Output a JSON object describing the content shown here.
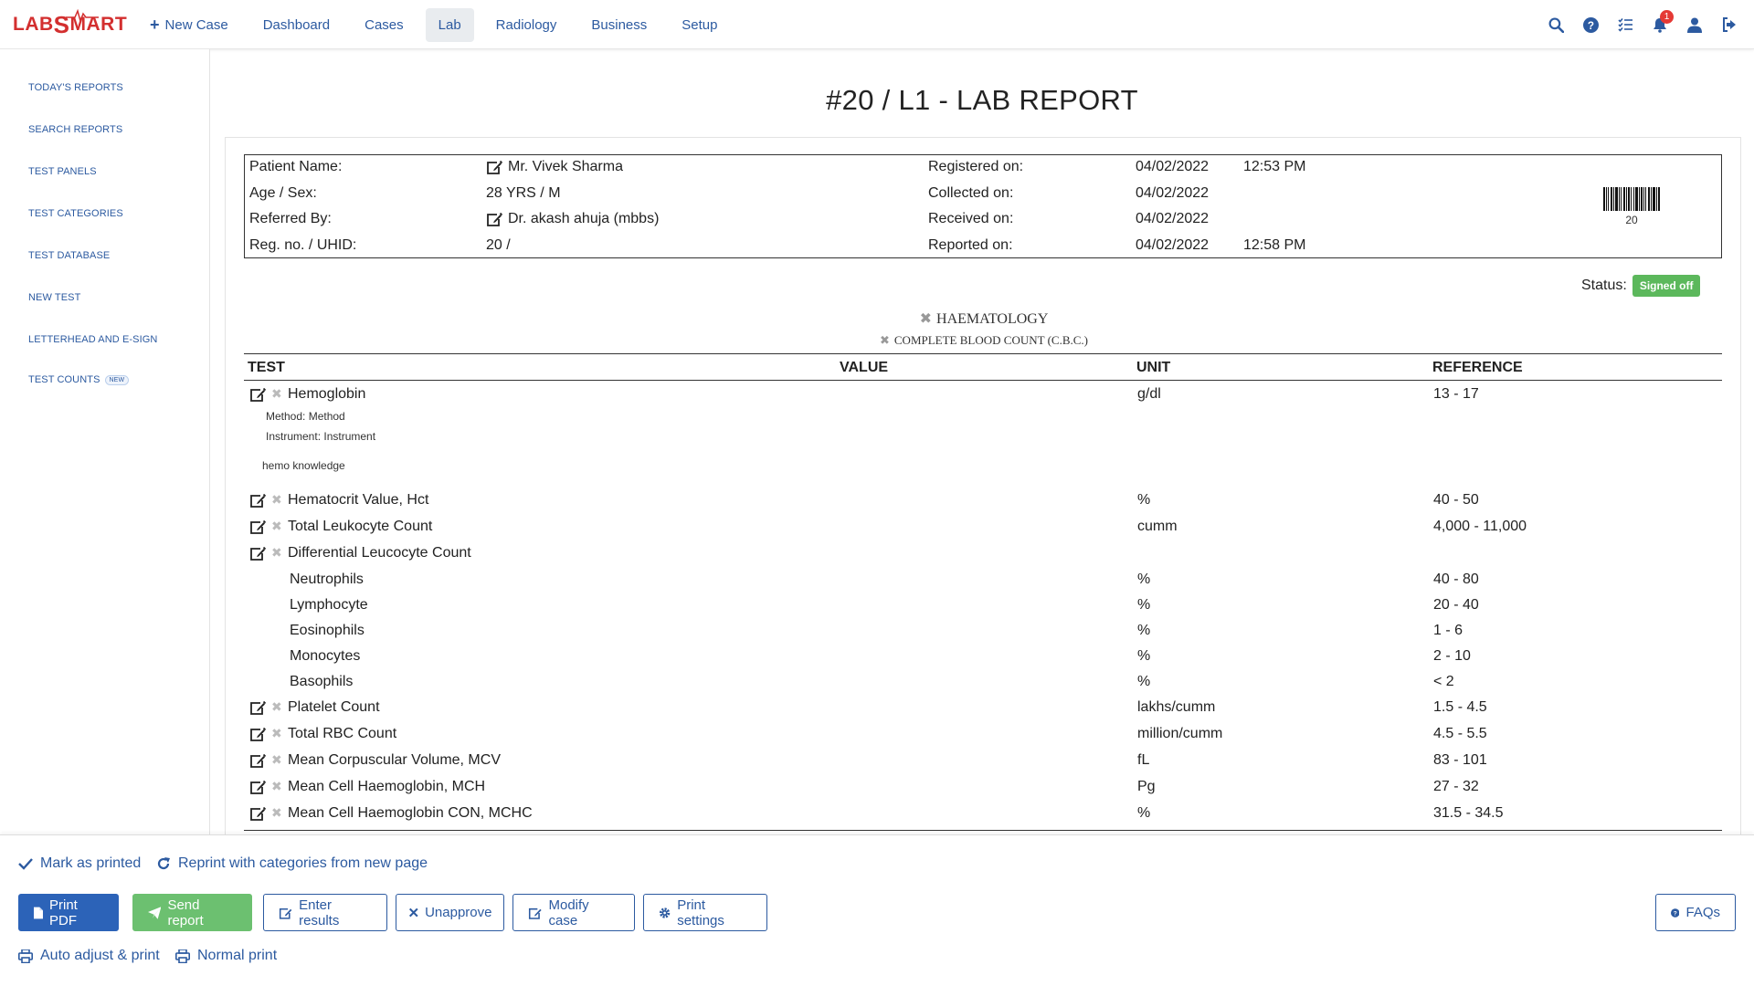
{
  "app": {
    "logo_text_1": "LAB",
    "logo_text_2": "S",
    "logo_text_3": "MART"
  },
  "nav": {
    "new_case": "New Case",
    "items": [
      "Dashboard",
      "Cases",
      "Lab",
      "Radiology",
      "Business",
      "Setup"
    ],
    "active": "Lab",
    "notification_count": "1"
  },
  "sidebar": {
    "items": [
      "TODAY'S REPORTS",
      "SEARCH REPORTS",
      "TEST PANELS",
      "TEST CATEGORIES",
      "TEST DATABASE",
      "NEW TEST",
      "LETTERHEAD AND E-SIGN",
      "TEST COUNTS"
    ],
    "new_tag": "NEW"
  },
  "report": {
    "title": "#20 / L1 - LAB REPORT",
    "patient_name_label": "Patient Name:",
    "patient_name": "Mr. Vivek Sharma",
    "age_sex_label": "Age / Sex:",
    "age_sex": "28 YRS / M",
    "referred_by_label": "Referred By:",
    "referred_by": "Dr. akash ahuja (mbbs)",
    "reg_label": "Reg. no. / UHID:",
    "reg": "20 /",
    "registered_label": "Registered on:",
    "registered_date": "04/02/2022",
    "registered_time": "12:53 PM",
    "collected_label": "Collected on:",
    "collected_date": "04/02/2022",
    "received_label": "Received on:",
    "received_date": "04/02/2022",
    "reported_label": "Reported on:",
    "reported_date": "04/02/2022",
    "reported_time": "12:58 PM",
    "barcode_number": "20",
    "status_label": "Status:",
    "status": "Signed off",
    "category": "HAEMATOLOGY",
    "panel": "COMPLETE BLOOD COUNT (C.B.C.)",
    "columns": {
      "test": "TEST",
      "value": "VALUE",
      "unit": "UNIT",
      "reference": "REFERENCE"
    },
    "method": "Method: Method",
    "instrument": "Instrument: Instrument",
    "knowledge": "hemo knowledge",
    "rows": [
      {
        "name": "Hemoglobin",
        "unit": "g/dl",
        "ref": "13 - 17"
      },
      {
        "name": "Hematocrit Value, Hct",
        "unit": "%",
        "ref": "40 - 50"
      },
      {
        "name": "Total Leukocyte Count",
        "unit": "cumm",
        "ref": "4,000 - 11,000"
      },
      {
        "name": "Differential Leucocyte Count",
        "unit": "",
        "ref": ""
      },
      {
        "name": "Neutrophils",
        "unit": "%",
        "ref": "40 - 80"
      },
      {
        "name": "Lymphocyte",
        "unit": "%",
        "ref": "20 - 40"
      },
      {
        "name": "Eosinophils",
        "unit": "%",
        "ref": "1 - 6"
      },
      {
        "name": "Monocytes",
        "unit": "%",
        "ref": "2 - 10"
      },
      {
        "name": "Basophils",
        "unit": "%",
        "ref": "< 2"
      },
      {
        "name": "Platelet Count",
        "unit": "lakhs/cumm",
        "ref": "1.5 - 4.5"
      },
      {
        "name": "Total RBC Count",
        "unit": "million/cumm",
        "ref": "4.5 - 5.5"
      },
      {
        "name": "Mean Corpuscular Volume, MCV",
        "unit": "fL",
        "ref": "83 - 101"
      },
      {
        "name": "Mean Cell Haemoglobin, MCH",
        "unit": "Pg",
        "ref": "27 - 32"
      },
      {
        "name": "Mean Cell Haemoglobin CON, MCHC",
        "unit": "%",
        "ref": "31.5 - 34.5"
      }
    ]
  },
  "actions": {
    "mark_printed": "Mark as printed",
    "reprint": "Reprint with categories from new page",
    "print_pdf": "Print PDF",
    "send_report": "Send report",
    "enter_results": "Enter results",
    "unapprove": "Unapprove",
    "modify_case": "Modify case",
    "print_settings": "Print settings",
    "faqs": "FAQs",
    "auto_adjust": "Auto adjust & print",
    "normal_print": "Normal print"
  },
  "colors": {
    "primary": "#2c63b8",
    "success": "#6cc070",
    "link": "#2c5aa0",
    "danger": "#d32f2f"
  }
}
